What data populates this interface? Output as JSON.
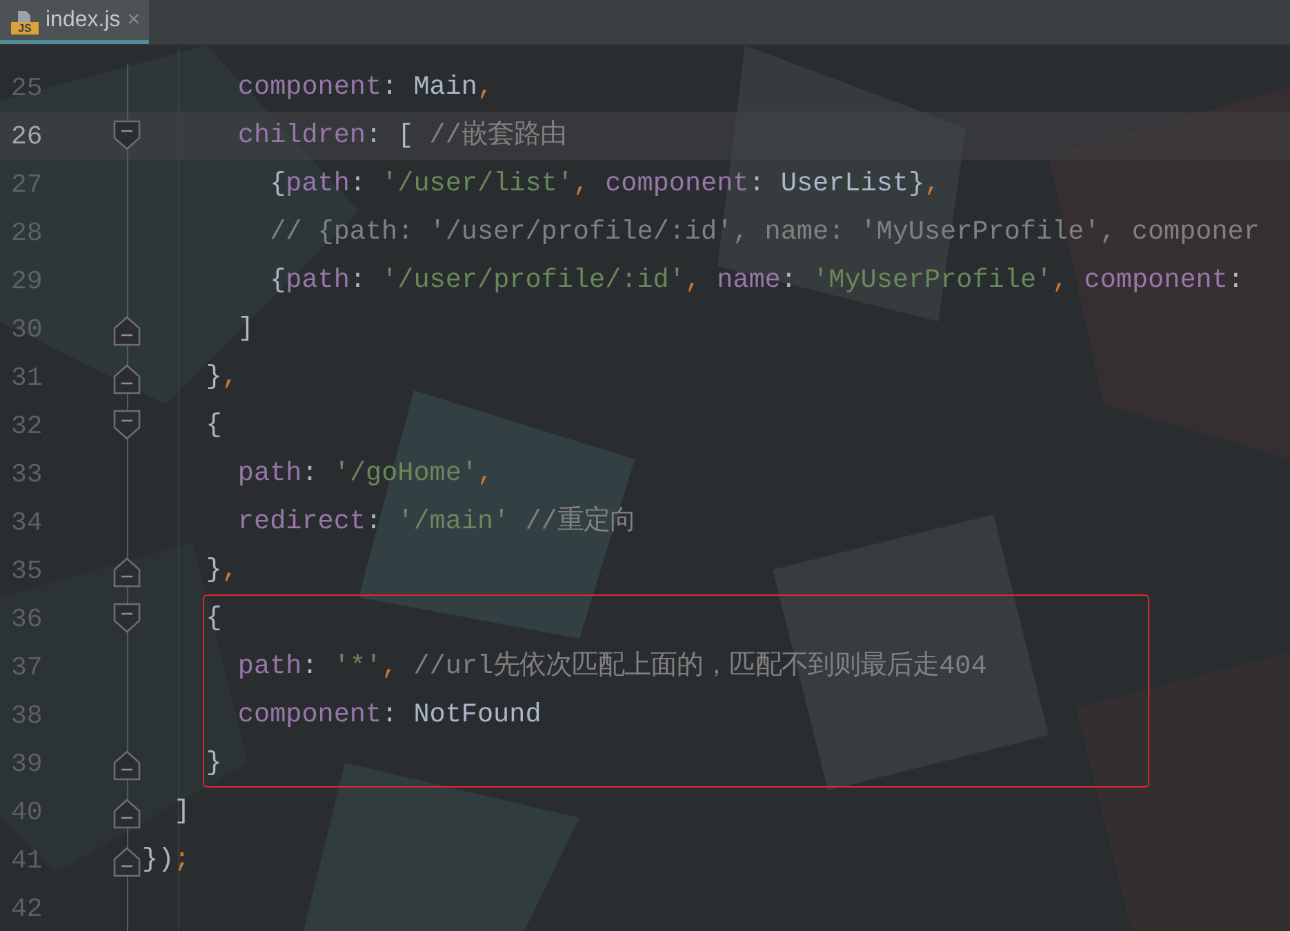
{
  "tabs": [
    {
      "label": "index.js",
      "badge": "JS",
      "close": "×",
      "selected": true
    }
  ],
  "lines": [
    {
      "number": "25",
      "current": false,
      "highlighted": false,
      "tokens": [
        {
          "kind": "prop",
          "text": "      component"
        },
        {
          "kind": "plain",
          "text": ": Main"
        },
        {
          "kind": "punc",
          "text": ","
        }
      ]
    },
    {
      "number": "26",
      "current": true,
      "highlighted": false,
      "fold": {
        "opening": true
      },
      "tokens": [
        {
          "kind": "prop",
          "text": "      children"
        },
        {
          "kind": "plain",
          "text": ": [ "
        },
        {
          "kind": "comment",
          "text": "//嵌套路由"
        }
      ]
    },
    {
      "number": "27",
      "current": false,
      "highlighted": false,
      "tokens": [
        {
          "kind": "plain",
          "text": "        {"
        },
        {
          "kind": "prop",
          "text": "path"
        },
        {
          "kind": "plain",
          "text": ": "
        },
        {
          "kind": "str",
          "text": "'/user/list'"
        },
        {
          "kind": "punc",
          "text": ", "
        },
        {
          "kind": "prop",
          "text": "component"
        },
        {
          "kind": "plain",
          "text": ": UserList}"
        },
        {
          "kind": "punc",
          "text": ","
        }
      ]
    },
    {
      "number": "28",
      "current": false,
      "highlighted": false,
      "tokens": [
        {
          "kind": "comment",
          "text": "        // {path: '/user/profile/:id', name: 'MyUserProfile', componer"
        }
      ]
    },
    {
      "number": "29",
      "current": false,
      "highlighted": false,
      "tokens": [
        {
          "kind": "plain",
          "text": "        {"
        },
        {
          "kind": "prop",
          "text": "path"
        },
        {
          "kind": "plain",
          "text": ": "
        },
        {
          "kind": "str",
          "text": "'/user/profile/:id'"
        },
        {
          "kind": "punc",
          "text": ", "
        },
        {
          "kind": "prop",
          "text": "name"
        },
        {
          "kind": "plain",
          "text": ": "
        },
        {
          "kind": "str",
          "text": "'MyUserProfile'"
        },
        {
          "kind": "punc",
          "text": ", "
        },
        {
          "kind": "prop",
          "text": "component"
        },
        {
          "kind": "plain",
          "text": ":"
        }
      ]
    },
    {
      "number": "30",
      "current": false,
      "highlighted": false,
      "fold": {
        "opening": false
      },
      "tokens": [
        {
          "kind": "plain",
          "text": "      ]"
        }
      ]
    },
    {
      "number": "31",
      "current": false,
      "highlighted": false,
      "fold": {
        "opening": false
      },
      "tokens": [
        {
          "kind": "plain",
          "text": "    }"
        },
        {
          "kind": "punc",
          "text": ","
        }
      ]
    },
    {
      "number": "32",
      "current": false,
      "highlighted": false,
      "fold": {
        "opening": true
      },
      "tokens": [
        {
          "kind": "plain",
          "text": "    {"
        }
      ]
    },
    {
      "number": "33",
      "current": false,
      "highlighted": false,
      "tokens": [
        {
          "kind": "prop",
          "text": "      path"
        },
        {
          "kind": "plain",
          "text": ": "
        },
        {
          "kind": "str",
          "text": "'/goHome'"
        },
        {
          "kind": "punc",
          "text": ","
        }
      ]
    },
    {
      "number": "34",
      "current": false,
      "highlighted": false,
      "tokens": [
        {
          "kind": "prop",
          "text": "      redirect"
        },
        {
          "kind": "plain",
          "text": ": "
        },
        {
          "kind": "str",
          "text": "'/main'"
        },
        {
          "kind": "comment",
          "text": " //重定向"
        }
      ]
    },
    {
      "number": "35",
      "current": false,
      "highlighted": false,
      "fold": {
        "opening": false
      },
      "tokens": [
        {
          "kind": "plain",
          "text": "    }"
        },
        {
          "kind": "punc",
          "text": ","
        }
      ]
    },
    {
      "number": "36",
      "current": false,
      "highlighted": true,
      "fold": {
        "opening": true
      },
      "tokens": [
        {
          "kind": "plain",
          "text": "    {"
        }
      ]
    },
    {
      "number": "37",
      "current": false,
      "highlighted": true,
      "tokens": [
        {
          "kind": "prop",
          "text": "      path"
        },
        {
          "kind": "plain",
          "text": ": "
        },
        {
          "kind": "str",
          "text": "'*'"
        },
        {
          "kind": "punc",
          "text": ", "
        },
        {
          "kind": "comment",
          "text": "//url先依次匹配上面的，匹配不到则最后走404"
        }
      ]
    },
    {
      "number": "38",
      "current": false,
      "highlighted": true,
      "tokens": [
        {
          "kind": "prop",
          "text": "      component"
        },
        {
          "kind": "plain",
          "text": ": NotFound"
        }
      ]
    },
    {
      "number": "39",
      "current": false,
      "highlighted": true,
      "fold": {
        "opening": false
      },
      "tokens": [
        {
          "kind": "plain",
          "text": "    }"
        }
      ]
    },
    {
      "number": "40",
      "current": false,
      "highlighted": false,
      "fold": {
        "opening": false
      },
      "tokens": [
        {
          "kind": "plain",
          "text": "  ]"
        }
      ]
    },
    {
      "number": "41",
      "current": false,
      "highlighted": false,
      "fold": {
        "opening": false
      },
      "tokens": [
        {
          "kind": "plain",
          "text": "})"
        },
        {
          "kind": "punc",
          "text": ";"
        }
      ]
    },
    {
      "number": "42",
      "current": false,
      "highlighted": false
    }
  ]
}
